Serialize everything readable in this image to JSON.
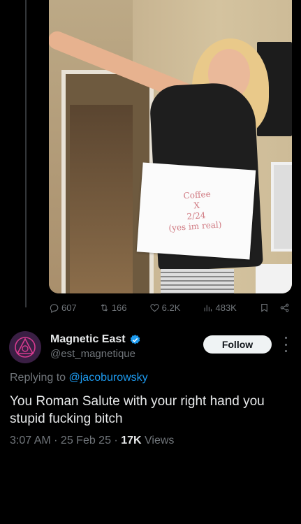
{
  "media": {
    "sign_lines": [
      "Coffee",
      "X",
      "2/24",
      "(yes im real)"
    ]
  },
  "actions": {
    "replies": "607",
    "reposts": "166",
    "likes": "6.2K",
    "views": "483K"
  },
  "reply": {
    "author_name": "Magnetic East",
    "handle": "@est_magnetique",
    "follow_label": "Follow",
    "replying_prefix": "Replying to",
    "replying_to": "@jacoburowsky",
    "text": "You Roman Salute with your right hand you stupid fucking bitch",
    "time": "3:07 AM",
    "date": "25 Feb 25",
    "views_count": "17K",
    "views_label": "Views"
  },
  "colors": {
    "background": "#000000",
    "accent": "#1d9bf0",
    "muted": "#71767b",
    "text": "#e7e9ea"
  },
  "icons": [
    "reply-icon",
    "repost-icon",
    "like-icon",
    "views-icon",
    "bookmark-icon",
    "share-icon",
    "verified-icon",
    "more-icon"
  ]
}
